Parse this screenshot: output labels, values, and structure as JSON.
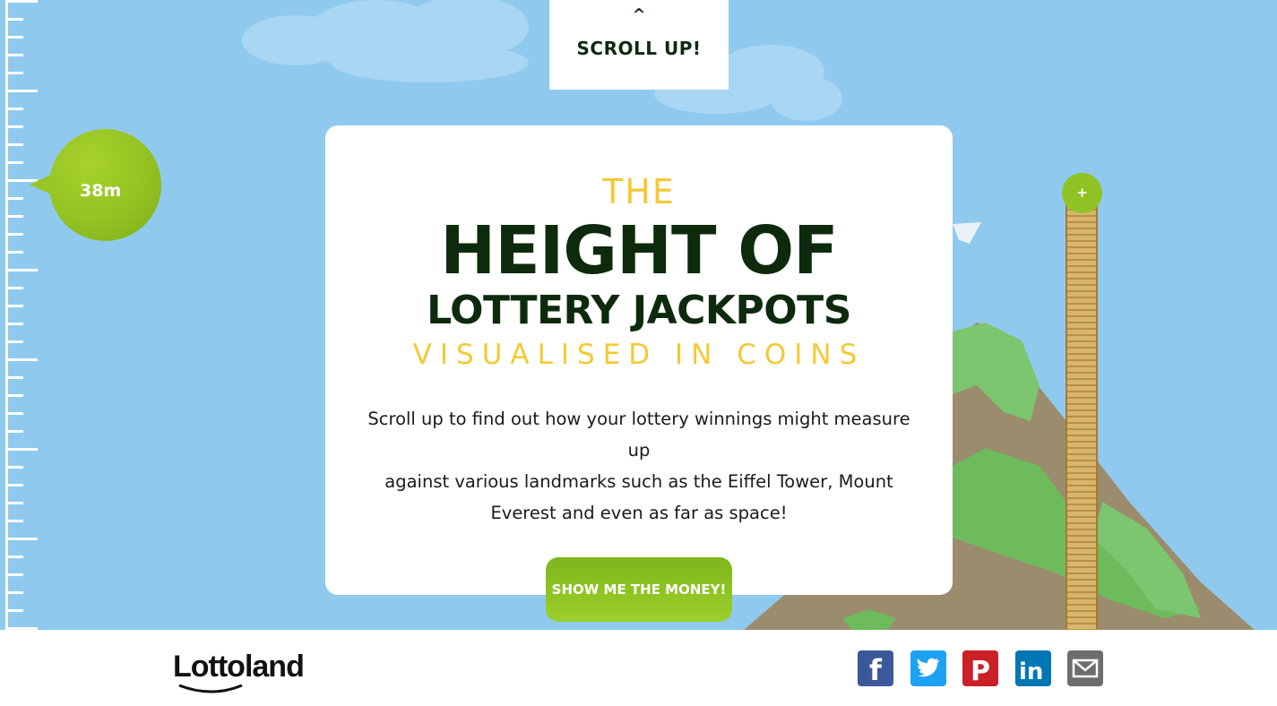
{
  "scroll_tab": {
    "chevron": "^",
    "label": "SCROLL UP!"
  },
  "height_bubble": {
    "label": "38m"
  },
  "hero": {
    "the": "THE",
    "line1": "HEIGHT OF",
    "line2": "LOTTERY JACKPOTS",
    "line3": "VISUALISED IN COINS",
    "intro_line1": "Scroll up to find out how your lottery winnings might measure up",
    "intro_line2": "against various landmarks such as the Eiffel Tower, Mount",
    "intro_line3": "Everest and even as far as space!"
  },
  "cta": {
    "label": "SHOW ME THE MONEY!"
  },
  "coin_stack": {
    "button_label": "+"
  },
  "footer": {
    "logo": "Lottoland",
    "share_icons": [
      "facebook-icon",
      "twitter-icon",
      "pinterest-icon",
      "linkedin-icon",
      "email-icon"
    ]
  },
  "colors": {
    "sky": "#8fcaee",
    "title_yellow": "#f4c935",
    "title_dark": "#0d2a0d",
    "accent_green": "#93c222",
    "facebook": "#3b5998",
    "twitter": "#1da1f2",
    "pinterest": "#cb2027",
    "linkedin": "#0077b5",
    "email": "#6d6d6d"
  }
}
